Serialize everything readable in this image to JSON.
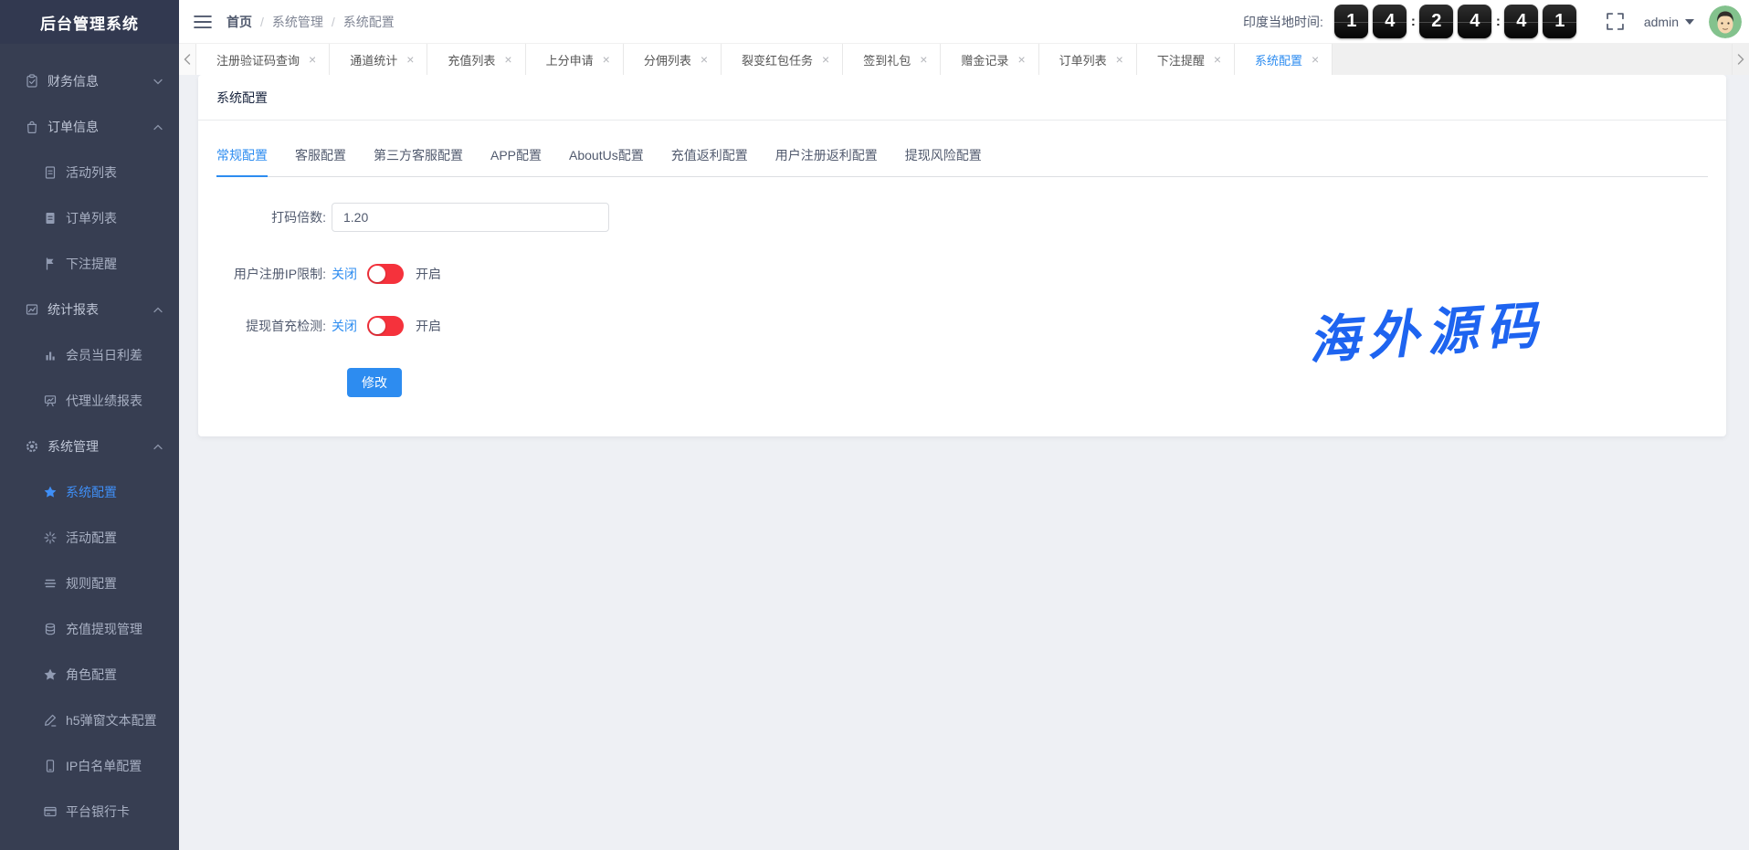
{
  "app": {
    "logo_title": "后台管理系统"
  },
  "header": {
    "breadcrumb": {
      "items": [
        "首页",
        "系统管理",
        "系统配置"
      ],
      "separator": "/"
    },
    "clock": {
      "label": "印度当地时间:",
      "digits": [
        "1",
        "4",
        "2",
        "4",
        "4",
        "1"
      ],
      "separator": ":"
    },
    "user": {
      "name": "admin"
    }
  },
  "tabs_bar": {
    "tabs": [
      {
        "label": "注册验证码查询",
        "active": false
      },
      {
        "label": "通道统计",
        "active": false
      },
      {
        "label": "充值列表",
        "active": false
      },
      {
        "label": "上分申请",
        "active": false
      },
      {
        "label": "分佣列表",
        "active": false
      },
      {
        "label": "裂变红包任务",
        "active": false
      },
      {
        "label": "签到礼包",
        "active": false
      },
      {
        "label": "赠金记录",
        "active": false
      },
      {
        "label": "订单列表",
        "active": false
      },
      {
        "label": "下注提醒",
        "active": false
      },
      {
        "label": "系统配置",
        "active": true
      }
    ]
  },
  "sidebar": {
    "items": [
      {
        "label": "财务信息",
        "type": "group",
        "expanded": false,
        "icon": "clipboard-check-icon"
      },
      {
        "label": "订单信息",
        "type": "group",
        "expanded": true,
        "icon": "shopping-bag-icon"
      },
      {
        "label": "活动列表",
        "type": "child",
        "icon": "document-icon"
      },
      {
        "label": "订单列表",
        "type": "child",
        "icon": "document-filled-icon"
      },
      {
        "label": "下注提醒",
        "type": "child",
        "icon": "flag-icon"
      },
      {
        "label": "统计报表",
        "type": "group",
        "expanded": true,
        "icon": "trend-chart-icon"
      },
      {
        "label": "会员当日利差",
        "type": "child",
        "icon": "bar-chart-icon"
      },
      {
        "label": "代理业绩报表",
        "type": "child",
        "icon": "presentation-chart-icon"
      },
      {
        "label": "系统管理",
        "type": "group",
        "expanded": true,
        "icon": "gear-icon"
      },
      {
        "label": "系统配置",
        "type": "child",
        "active": true,
        "icon": "star-filled-icon"
      },
      {
        "label": "活动配置",
        "type": "child",
        "icon": "sparkle-icon"
      },
      {
        "label": "规则配置",
        "type": "child",
        "icon": "list-icon"
      },
      {
        "label": "充值提现管理",
        "type": "child",
        "icon": "database-icon"
      },
      {
        "label": "角色配置",
        "type": "child",
        "icon": "star-icon"
      },
      {
        "label": "h5弹窗文本配置",
        "type": "child",
        "icon": "pencil-icon"
      },
      {
        "label": "IP白名单配置",
        "type": "child",
        "icon": "phone-icon"
      },
      {
        "label": "平台银行卡",
        "type": "child",
        "icon": "bank-card-icon"
      }
    ]
  },
  "page": {
    "card_title": "系统配置",
    "config_tabs": [
      {
        "label": "常规配置",
        "active": true
      },
      {
        "label": "客服配置",
        "active": false
      },
      {
        "label": "第三方客服配置",
        "active": false
      },
      {
        "label": "APP配置",
        "active": false
      },
      {
        "label": "AboutUs配置",
        "active": false
      },
      {
        "label": "充值返利配置",
        "active": false
      },
      {
        "label": "用户注册返利配置",
        "active": false
      },
      {
        "label": "提现风险配置",
        "active": false
      }
    ],
    "form": {
      "rows": [
        {
          "label": "打码倍数:",
          "type": "input",
          "value": "1.20"
        },
        {
          "label": "用户注册IP限制:",
          "type": "switch",
          "off_label": "关闭",
          "on_label": "开启",
          "state": "off"
        },
        {
          "label": "提现首充检测:",
          "type": "switch",
          "off_label": "关闭",
          "on_label": "开启",
          "state": "off"
        }
      ],
      "submit_label": "修改"
    },
    "watermark": "海外源码"
  },
  "icons": {
    "close": "×"
  },
  "colors": {
    "accent_blue": "#2d8cf0",
    "active_link_blue": "#3f8ff7",
    "switch_red": "#f5323c",
    "sidebar_bg": "#373e52",
    "watermark_blue": "#1e64f0",
    "avatar_green": "#83c28d"
  }
}
